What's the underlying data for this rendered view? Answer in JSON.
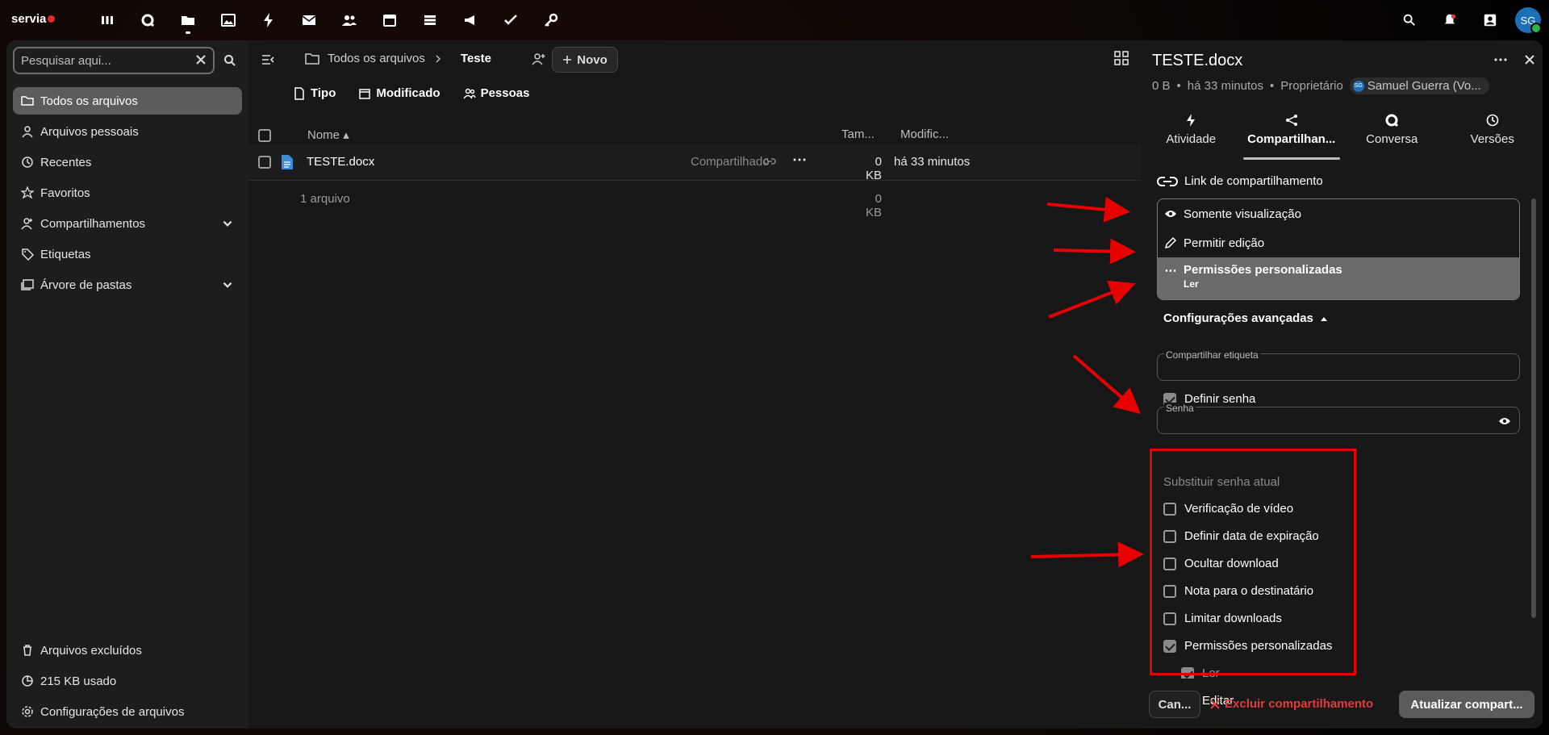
{
  "topbar": {
    "brand": "servia",
    "apps": [
      "dashboard-icon",
      "search-app-icon",
      "files-icon",
      "photos-icon",
      "activity-icon",
      "mail-icon",
      "contacts-icon",
      "calendar-icon",
      "deck-icon",
      "announcements-icon",
      "tasks-icon",
      "passwords-icon"
    ],
    "avatar_initials": "SG"
  },
  "leftnav": {
    "search_placeholder": "Pesquisar aqui...",
    "items": [
      {
        "label": "Todos os arquivos",
        "icon": "folder-icon",
        "active": true
      },
      {
        "label": "Arquivos pessoais",
        "icon": "user-icon"
      },
      {
        "label": "Recentes",
        "icon": "history-icon"
      },
      {
        "label": "Favoritos",
        "icon": "star-icon"
      },
      {
        "label": "Compartilhamentos",
        "icon": "share-user-icon"
      },
      {
        "label": "Etiquetas",
        "icon": "tag-icon"
      },
      {
        "label": "Árvore de pastas",
        "icon": "folder-tree-icon"
      }
    ],
    "bottom": {
      "trash": "Arquivos excluídos",
      "quota": "215 KB usado",
      "settings": "Configurações de arquivos"
    }
  },
  "files": {
    "breadcrumb": [
      "Todos os arquivos",
      "Teste"
    ],
    "new_label": "Novo",
    "filters": [
      "Tipo",
      "Modificado",
      "Pessoas"
    ],
    "headers": {
      "name": "Nome",
      "size": "Tam...",
      "modified": "Modific..."
    },
    "rows": [
      {
        "name": "TESTE.docx",
        "shared": "Compartilhado",
        "size": "0 KB",
        "modified": "há 33 minutos"
      }
    ],
    "summary": {
      "count": "1 arquivo",
      "size": "0 KB"
    }
  },
  "sidebar": {
    "title": "TESTE.docx",
    "meta": {
      "size": "0 B",
      "time": "há 33 minutos",
      "role": "Proprietário",
      "owner": "Samuel Guerra (Vo...",
      "owner_initials": "SG"
    },
    "tabs": [
      "Atividade",
      "Compartilhan...",
      "Conversa",
      "Versões"
    ],
    "link_title": "Link de compartilhamento",
    "permissions": {
      "view": "Somente visualização",
      "edit": "Permitir edição",
      "custom": "Permissões personalizadas",
      "custom_sub": "Ler"
    },
    "advanced_label": "Configurações avançadas",
    "share_label_field": "Compartilhar etiqueta",
    "set_password": "Definir senha",
    "password_field": "Senha",
    "replace_password": "Substituir senha atual",
    "options": [
      {
        "label": "Verificação de vídeo",
        "checked": false
      },
      {
        "label": "Definir data de expiração",
        "checked": false
      },
      {
        "label": "Ocultar download",
        "checked": false
      },
      {
        "label": "Nota para o destinatário",
        "checked": false
      },
      {
        "label": "Limitar downloads",
        "checked": false
      },
      {
        "label": "Permissões personalizadas",
        "checked": true
      }
    ],
    "sub_options": [
      {
        "label": "Ler",
        "checked": true
      },
      {
        "label": "Editar",
        "checked": false
      }
    ],
    "footer": {
      "cancel": "Can...",
      "delete": "Excluir compartilhamento",
      "update": "Atualizar compart..."
    }
  },
  "colors": {
    "accent_red": "#e60000",
    "background": "#171717",
    "selected": "#6a6a6a"
  }
}
